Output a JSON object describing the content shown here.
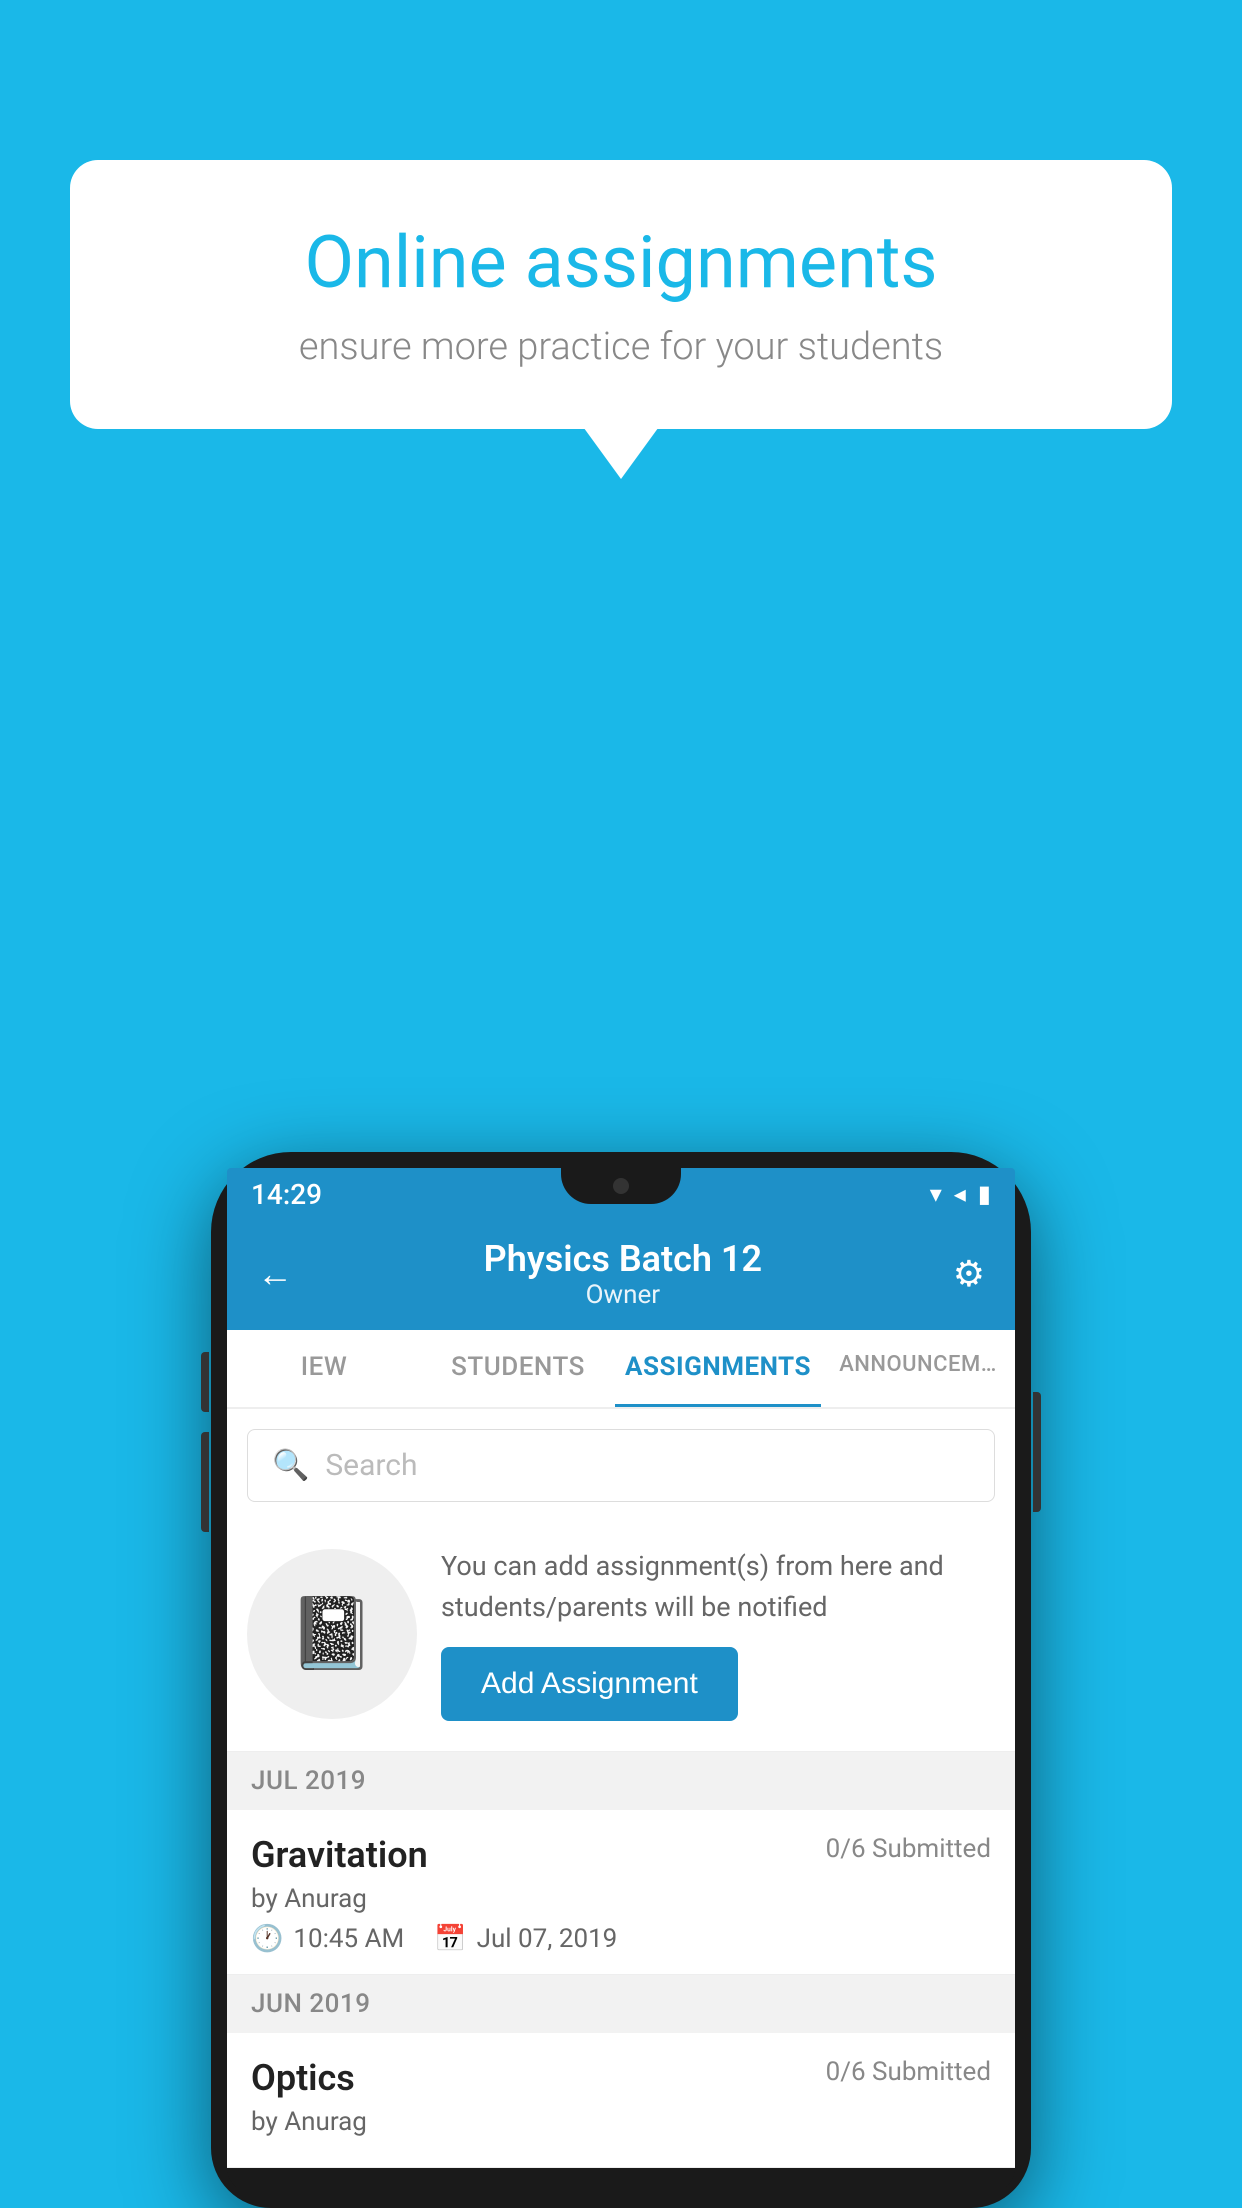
{
  "background_color": "#1ab8e8",
  "speech_bubble": {
    "title": "Online assignments",
    "subtitle": "ensure more practice for your students"
  },
  "phone": {
    "status_bar": {
      "time": "14:29"
    },
    "header": {
      "title": "Physics Batch 12",
      "subtitle": "Owner",
      "back_label": "←",
      "settings_label": "⚙"
    },
    "tabs": [
      {
        "label": "IEW",
        "active": false
      },
      {
        "label": "STUDENTS",
        "active": false
      },
      {
        "label": "ASSIGNMENTS",
        "active": true
      },
      {
        "label": "ANNOUNCEM…",
        "active": false
      }
    ],
    "search": {
      "placeholder": "Search"
    },
    "add_assignment_section": {
      "description_text": "You can add assignment(s) from here and students/parents will be notified",
      "button_label": "Add Assignment"
    },
    "sections": [
      {
        "month_label": "JUL 2019",
        "assignments": [
          {
            "name": "Gravitation",
            "submitted": "0/6 Submitted",
            "author": "by Anurag",
            "time": "10:45 AM",
            "date": "Jul 07, 2019"
          }
        ]
      },
      {
        "month_label": "JUN 2019",
        "assignments": [
          {
            "name": "Optics",
            "submitted": "0/6 Submitted",
            "author": "by Anurag",
            "time": "",
            "date": ""
          }
        ]
      }
    ]
  }
}
